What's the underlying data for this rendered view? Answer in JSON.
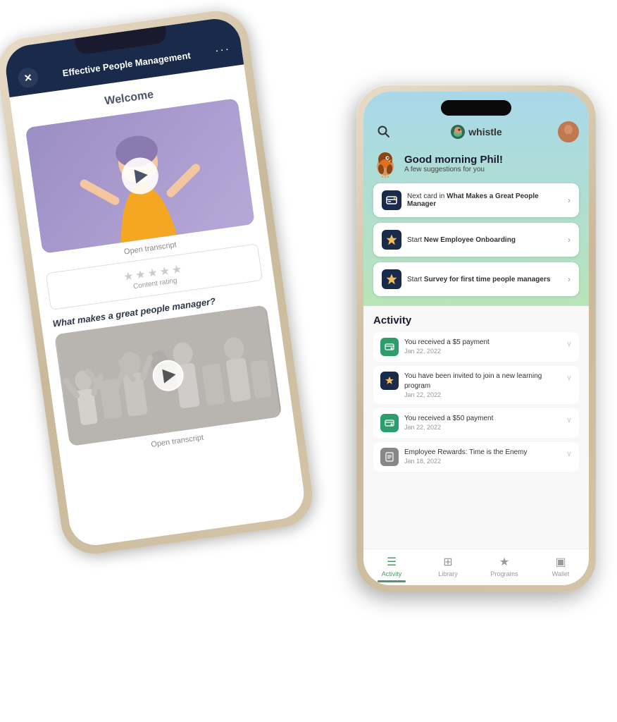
{
  "back_phone": {
    "header": {
      "title": "Effective People Management",
      "dots": "···",
      "close_label": "✕"
    },
    "screen": {
      "welcome": "Welcome",
      "transcript1": "Open transcript",
      "rating_stars": "★★★★★",
      "rating_label": "Content rating",
      "section2_title": "What makes a great people manager?",
      "transcript2": "Open transcript"
    }
  },
  "front_phone": {
    "logo": "whistle",
    "greeting": {
      "title": "Good morning Phil!",
      "subtitle": "A few suggestions for you"
    },
    "suggestions": [
      {
        "id": "s1",
        "text": "Next card in ",
        "bold": "What Makes a Great People Manager"
      },
      {
        "id": "s2",
        "text": "Start ",
        "bold": "New Employee Onboarding"
      },
      {
        "id": "s3",
        "text": "Start ",
        "bold": "Survey for first time people managers"
      }
    ],
    "activity": {
      "title": "Activity",
      "items": [
        {
          "id": "a1",
          "icon_type": "green",
          "text": "You received a $5 payment",
          "date": "Jan 22, 2022"
        },
        {
          "id": "a2",
          "icon_type": "dark",
          "text": "You have been invited to join a new learning program",
          "date": "Jan 22, 2022"
        },
        {
          "id": "a3",
          "icon_type": "green",
          "text": "You received a $50 payment",
          "date": "Jan 22, 2022"
        },
        {
          "id": "a4",
          "icon_type": "gray",
          "text": "Employee Rewards: Time is the Enemy",
          "date": "Jan 18, 2022"
        }
      ]
    },
    "nav": {
      "items": [
        {
          "label": "Activity",
          "active": true
        },
        {
          "label": "Library",
          "active": false
        },
        {
          "label": "Programs",
          "active": false
        },
        {
          "label": "Wallet",
          "active": false
        }
      ]
    }
  }
}
